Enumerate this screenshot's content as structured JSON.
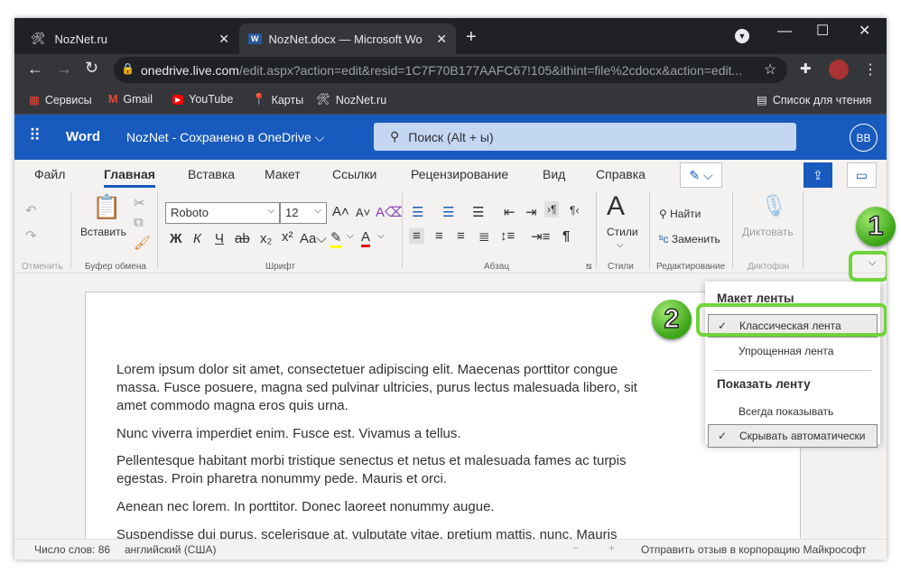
{
  "browser": {
    "tabs": [
      {
        "title": "NozNet.ru",
        "icon": "tools-icon"
      },
      {
        "title": "NozNet.docx — Microsoft Word",
        "icon": "word-icon"
      }
    ],
    "url_host": "onedrive.live.com",
    "url_rest": "/edit.aspx?action=edit&resid=1C7F70B177AAFC67!105&ithint=file%2cdocx&action=edit...",
    "bookmarks": [
      "Сервисы",
      "Gmail",
      "YouTube",
      "Карты",
      "NozNet.ru"
    ],
    "reading_list": "Список для чтения"
  },
  "word": {
    "app": "Word",
    "doc_title": "NozNet - Сохранено в OneDrive",
    "search_placeholder": "Поиск (Alt + ы)",
    "avatar": "BB",
    "brand_color": "#185abd"
  },
  "ribbon_tabs": [
    "Файл",
    "Главная",
    "Вставка",
    "Макет",
    "Ссылки",
    "Рецензирование",
    "Вид",
    "Справка"
  ],
  "active_tab": "Главная",
  "ribbon": {
    "undo_group": "Отменить",
    "paste": "Вставить",
    "clipboard_group": "Буфер обмена",
    "font_name": "Roboto",
    "font_size": "12",
    "font_group": "Шрифт",
    "paragraph_group": "Абзац",
    "styles": "Стили",
    "styles_group": "Стили",
    "find": "Найти",
    "replace": "Заменить",
    "editing_group": "Редактирование",
    "dictate": "Диктовать",
    "dictaphone_group": "Диктофон"
  },
  "document": {
    "paragraphs": [
      "Lorem ipsum dolor sit amet, consectetuer adipiscing elit. Maecenas porttitor congue",
      "massa. Fusce posuere, magna sed pulvinar ultricies, purus lectus malesuada libero, sit",
      "amet commodo magna eros quis urna.",
      "Nunc viverra imperdiet enim. Fusce est. Vivamus a tellus.",
      "Pellentesque habitant morbi tristique senectus et netus et malesuada fames ac turpis",
      "egestas. Proin pharetra nonummy pede. Mauris et orci.",
      "Aenean nec lorem. In porttitor. Donec laoreet nonummy augue.",
      "Suspendisse dui purus, scelerisque at, vulputate vitae, pretium mattis, nunc. Mauris"
    ]
  },
  "menu": {
    "section1": "Макет ленты",
    "items1": [
      "Классическая лента",
      "Упрощенная лента"
    ],
    "section2": "Показать ленту",
    "items2": [
      "Всегда показывать",
      "Скрывать автоматически"
    ]
  },
  "status": {
    "words": "Число слов: 86",
    "language": "английский (США)",
    "zoom_out": "−",
    "zoom_in": "+",
    "feedback": "Отправить отзыв в корпорацию Майкрософт"
  },
  "annotations": [
    "1",
    "2"
  ]
}
